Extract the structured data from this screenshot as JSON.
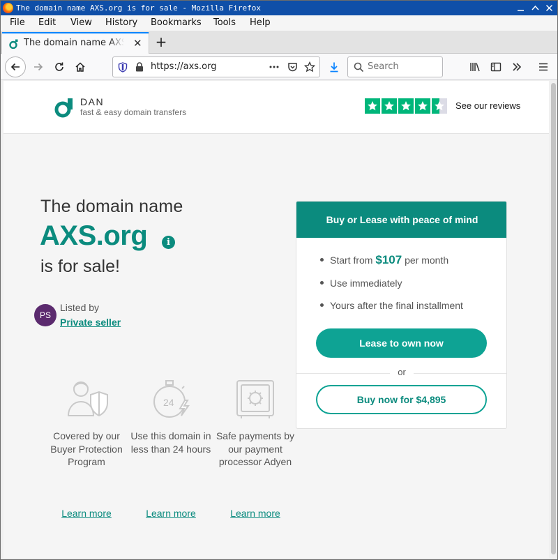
{
  "window": {
    "title": "The domain name AXS.org is for sale - Mozilla Firefox"
  },
  "menu": [
    "File",
    "Edit",
    "View",
    "History",
    "Bookmarks",
    "Tools",
    "Help"
  ],
  "tab": {
    "label": "The domain name AXS.org is for sale"
  },
  "nav": {
    "url": "https://axs.org",
    "search_placeholder": "Search"
  },
  "site": {
    "brand": "DAN",
    "tagline": "fast & easy domain transfers",
    "reviews_link": "See our reviews",
    "trustpilot_stars": 4.5,
    "headline_prefix": "The domain name",
    "domain": "AXS.org",
    "headline_suffix": "is for sale!",
    "listed_by_label": "Listed by",
    "seller_initials": "PS",
    "seller_name": "Private seller",
    "features": [
      {
        "icon": "buyer-protection-icon",
        "text": "Covered by our Buyer Protection Program",
        "link": "Learn more"
      },
      {
        "icon": "24-hours-icon",
        "text": "Use this domain in less than 24 hours",
        "link": "Learn more"
      },
      {
        "icon": "safe-payment-icon",
        "text": "Safe payments by our payment processor Adyen",
        "link": "Learn more"
      }
    ],
    "card": {
      "header": "Buy or Lease with peace of mind",
      "bullet1_prefix": "Start from",
      "bullet1_price": "$107",
      "bullet1_suffix": "per month",
      "bullet2": "Use immediately",
      "bullet3": "Yours after the final installment",
      "lease_button": "Lease to own now",
      "or_label": "or",
      "buy_button": "Buy now for $4,895"
    }
  },
  "colors": {
    "brand_teal": "#0b8b7e",
    "button_teal": "#0ea394",
    "trustpilot_green": "#00b67a",
    "titlebar_blue": "#0f4fa8",
    "avatar_purple": "#5b2a6e"
  }
}
